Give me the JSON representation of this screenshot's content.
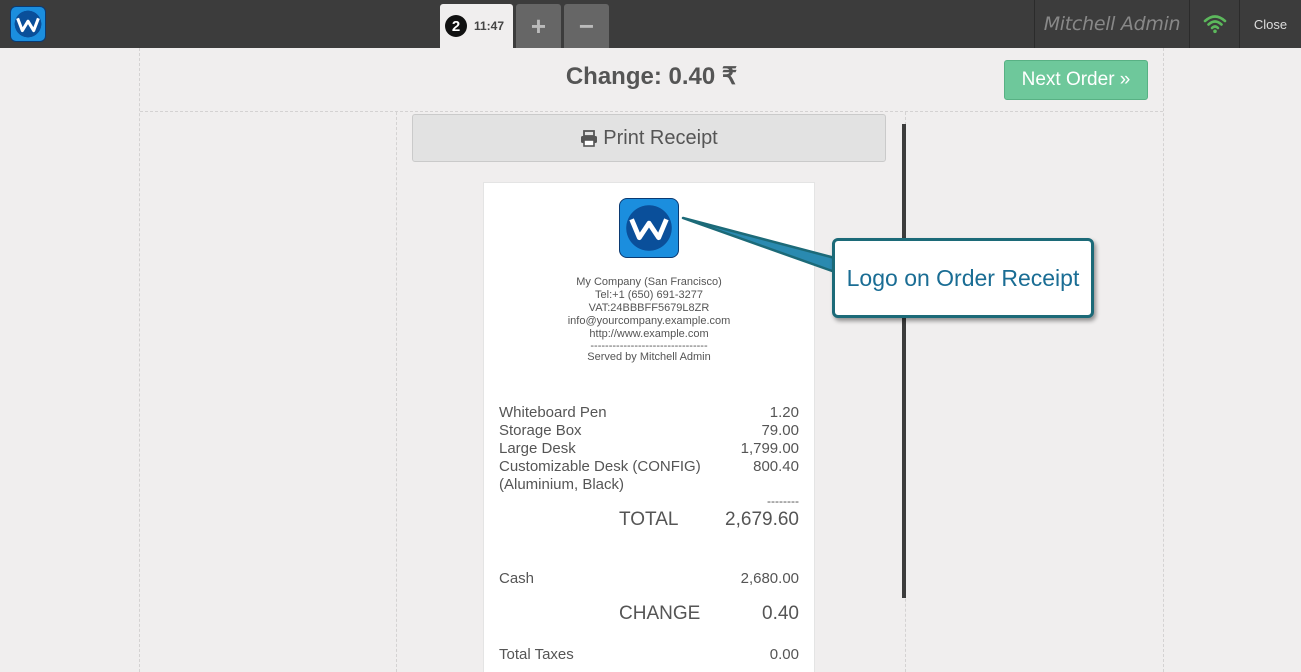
{
  "topbar": {
    "order_number": "2",
    "order_time": "11:47",
    "add_symbol": "+",
    "remove_symbol": "−",
    "user_name": "Mitchell Admin",
    "close_label": "Close",
    "icons": {
      "app_logo": "company-logo-icon",
      "wifi": "wifi-icon"
    },
    "colors": {
      "bar": "#3c3c3c",
      "wifi": "#5cb85c"
    }
  },
  "screen": {
    "change_label": "Change: 0.40 ₹",
    "next_order_label": "Next Order »",
    "print_receipt_label": "Print Receipt",
    "colors": {
      "next_order": "#6ec89b"
    }
  },
  "receipt": {
    "contact_lines": [
      "My Company (San Francisco)",
      "Tel:+1 (650) 691-3277",
      "VAT:24BBBFF5679L8ZR",
      "info@yourcompany.example.com",
      "http://www.example.com",
      "--------------------------------",
      "Served by Mitchell Admin"
    ],
    "lines": [
      {
        "name": "Whiteboard Pen",
        "price": "1.20"
      },
      {
        "name": "Storage Box",
        "price": "79.00"
      },
      {
        "name": "Large Desk",
        "price": "1,799.00"
      },
      {
        "name": "Customizable Desk (CONFIG) (Aluminium, Black)",
        "price": "800.40"
      }
    ],
    "separator": "--------",
    "total_label": "TOTAL",
    "total_value": "2,679.60",
    "payment_label": "Cash",
    "payment_value": "2,680.00",
    "change_label": "CHANGE",
    "change_value": "0.40",
    "taxes_label": "Total Taxes",
    "taxes_value": "0.00"
  },
  "callout": {
    "text": "Logo on Order Receipt",
    "color": "#1c6a78"
  }
}
